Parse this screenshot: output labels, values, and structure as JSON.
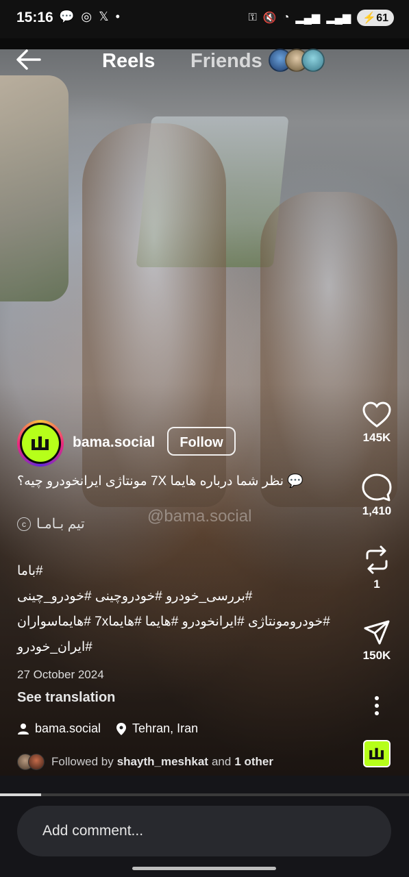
{
  "status_bar": {
    "time": "15:16",
    "notification_icons": [
      "message-icon",
      "instagram-icon",
      "x-icon",
      "dot-icon"
    ],
    "battery": "61"
  },
  "nav": {
    "tab_reels": "Reels",
    "tab_friends": "Friends"
  },
  "video": {
    "watermark": "@bama.social"
  },
  "author": {
    "username": "bama.social",
    "follow_label": "Follow"
  },
  "caption": {
    "line1": "💬 نظر شما درباره هایما 7X مونتاژی ایرانخودرو چیه؟",
    "team": "تیم بـامـا",
    "hashtags": [
      "#باما",
      "#بررسی_خودرو #خودروچینی #خودرو_چینی",
      "#خودرومونتاژی #ایرانخودرو #هایما #هایما7x #هایماسواران",
      "#ایران_خودرو"
    ]
  },
  "date": "27 October 2024",
  "see_translation": "See translation",
  "meta": {
    "account": "bama.social",
    "location": "Tehran, Iran"
  },
  "followed_by": {
    "prefix": "Followed by",
    "user": "shayth_meshkat",
    "middle": "and",
    "other": "1 other"
  },
  "actions": {
    "likes": "145K",
    "comments": "1,410",
    "reposts": "1",
    "shares": "150K"
  },
  "progress": 0.1,
  "comment": {
    "placeholder": "Add comment..."
  },
  "colors": {
    "brand_green": "#b6ff1a",
    "background": "#0b0b0b"
  }
}
